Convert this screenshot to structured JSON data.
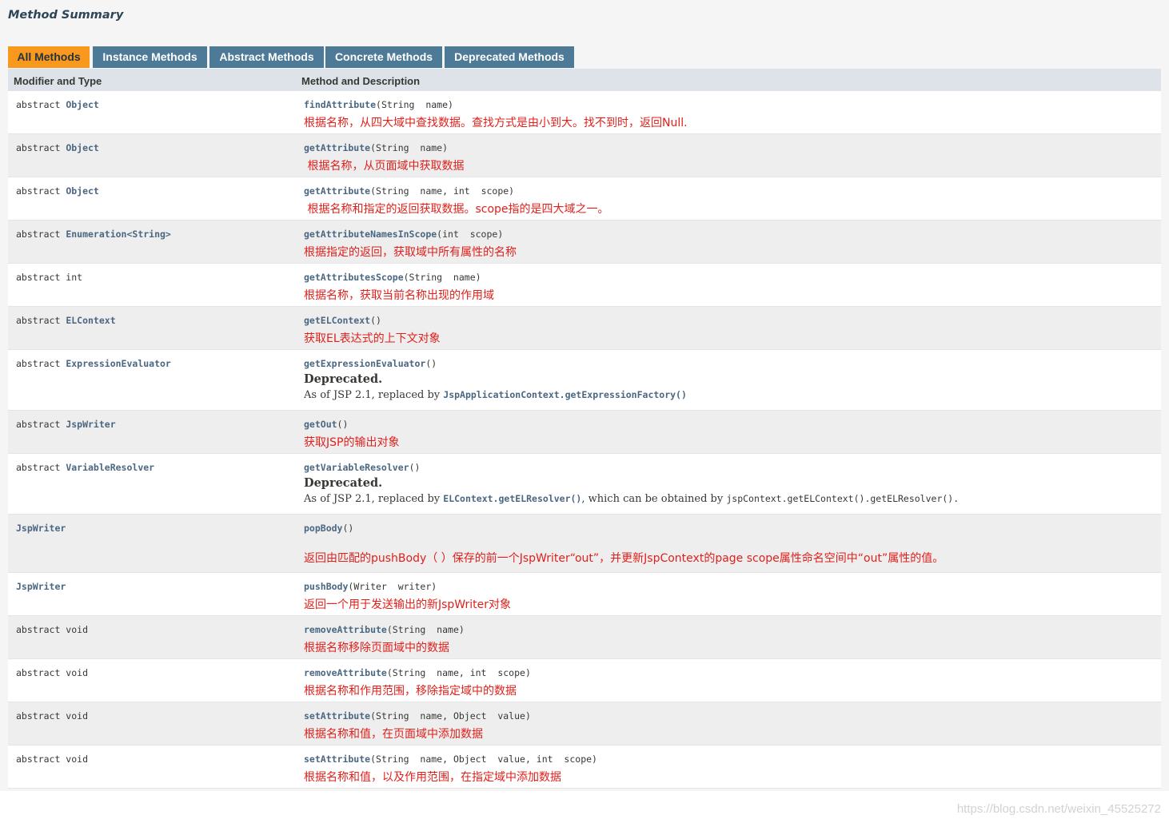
{
  "title": "Method Summary",
  "tabs": [
    {
      "label": "All Methods",
      "active": true
    },
    {
      "label": "Instance Methods",
      "active": false
    },
    {
      "label": "Abstract Methods",
      "active": false
    },
    {
      "label": "Concrete Methods",
      "active": false
    },
    {
      "label": "Deprecated Methods",
      "active": false
    }
  ],
  "header": {
    "col1": "Modifier and Type",
    "col2": "Method and Description"
  },
  "rows": [
    {
      "modifier": "abstract ",
      "type": "Object",
      "method": "findAttribute",
      "params": "(String  name)",
      "note": "根据名称，从四大域中查找数据。查找方式是由小到大。找不到时，返回Null."
    },
    {
      "modifier": "abstract ",
      "type": "Object",
      "method": "getAttribute",
      "params": "(String  name)",
      "note": " 根据名称，从页面域中获取数据"
    },
    {
      "modifier": "abstract ",
      "type": "Object",
      "method": "getAttribute",
      "params": "(String  name, int  scope)",
      "note": " 根据名称和指定的返回获取数据。scope指的是四大域之一。"
    },
    {
      "modifier": "abstract ",
      "type": "Enumeration<String>",
      "method": "getAttributeNamesInScope",
      "params": "(int  scope)",
      "note": "根据指定的返回，获取域中所有属性的名称"
    },
    {
      "modifier": "abstract int",
      "type": "",
      "method": "getAttributesScope",
      "params": "(String  name)",
      "note": "根据名称，获取当前名称出现的作用域"
    },
    {
      "modifier": "abstract ",
      "type": "ELContext",
      "method": "getELContext",
      "params": "()",
      "note": "获取EL表达式的上下文对象"
    },
    {
      "modifier": "abstract ",
      "type": "ExpressionEvaluator",
      "method": "getExpressionEvaluator",
      "params": "()",
      "deprecated": "Deprecated.",
      "dep_prefix": "As of JSP 2.1, replaced by ",
      "dep_code": "JspApplicationContext.getExpressionFactory()",
      "dep_suffix": ""
    },
    {
      "modifier": "abstract ",
      "type": "JspWriter",
      "method": "getOut",
      "params": "()",
      "note": "获取JSP的输出对象"
    },
    {
      "modifier": "abstract ",
      "type": "VariableResolver",
      "method": "getVariableResolver",
      "params": "()",
      "deprecated": "Deprecated.",
      "dep_prefix": "As of JSP 2.1, replaced by ",
      "dep_code": "ELContext.getELResolver()",
      "dep_suffix": ", which can be obtained by ",
      "dep_code2": "jspContext.getELContext().getELResolver()."
    },
    {
      "modifier": "",
      "type": "JspWriter",
      "method": "popBody",
      "params": "()",
      "note": "返回由匹配的pushBody（ ）保存的前一个JspWriter“out”，并更新JspContext的page scope属性命名空间中“out”属性的值。"
    },
    {
      "modifier": "",
      "type": "JspWriter",
      "method": "pushBody",
      "params": "(Writer  writer)",
      "note": "返回一个用于发送输出的新JspWriter对象"
    },
    {
      "modifier": "abstract void",
      "type": "",
      "method": "removeAttribute",
      "params": "(String  name)",
      "note": "根据名称移除页面域中的数据"
    },
    {
      "modifier": "abstract void",
      "type": "",
      "method": "removeAttribute",
      "params": "(String  name, int  scope)",
      "note": "根据名称和作用范围，移除指定域中的数据"
    },
    {
      "modifier": "abstract void",
      "type": "",
      "method": "setAttribute",
      "params": "(String  name, Object  value)",
      "note": "根据名称和值，在页面域中添加数据"
    },
    {
      "modifier": "abstract void",
      "type": "",
      "method": "setAttribute",
      "params": "(String  name, Object  value, int  scope)",
      "note": "根据名称和值，以及作用范围，在指定域中添加数据"
    }
  ],
  "watermark": "https://blog.csdn.net/weixin_45525272"
}
